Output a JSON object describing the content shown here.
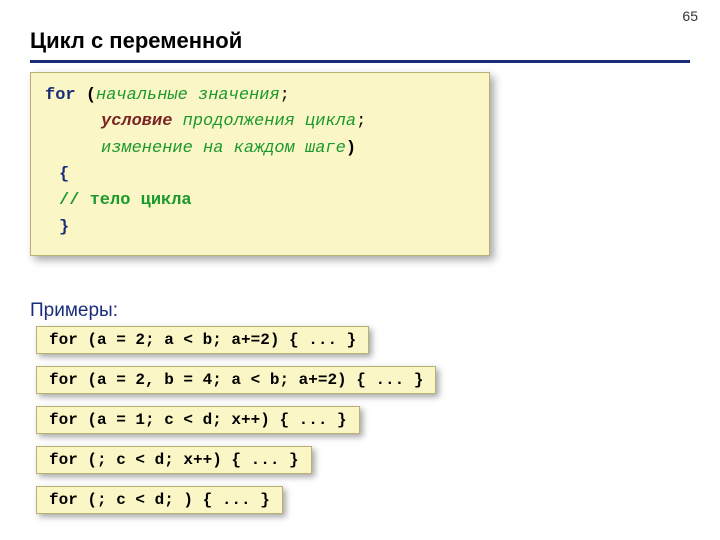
{
  "page_number": "65",
  "title": "Цикл с переменной",
  "syntax": {
    "for": "for",
    "open": "(",
    "arg1": "начальные значения",
    "semi1": ";",
    "arg2_strong": "условие",
    "arg2_rest": " продолжения цикла",
    "semi2": ";",
    "arg3": "изменение на каждом шаге",
    "close": ")",
    "brace_open": "{",
    "comment": "// тело цикла",
    "brace_close": "}"
  },
  "examples_label": "Примеры:",
  "examples": [
    "for (a = 2; a < b; a+=2) { ... }",
    "for (a = 2, b = 4; a < b; a+=2) { ... }",
    "for (a = 1; c < d; x++) { ... }",
    "for (; c < d; x++) { ... }",
    "for (; c < d; ) { ... }"
  ]
}
